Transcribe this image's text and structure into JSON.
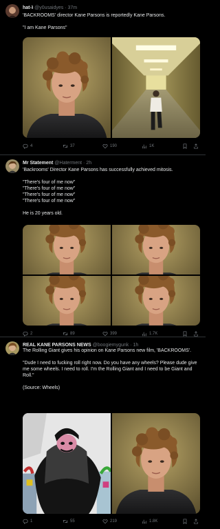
{
  "tweets": [
    {
      "name": "hat-ʇ",
      "handle_time": "@y0usaidyes · 37m",
      "lines": [
        "'BACKROOMS' director Kane Parsons is reportedly Kane Parsons.",
        "",
        "\"I am Kane Parsons\""
      ],
      "stats": {
        "replies": "4",
        "retweets": "37",
        "likes": "190",
        "views": "1K"
      }
    },
    {
      "name": "Mr Statement",
      "handle_time": "@Haterment · 2h",
      "lines": [
        "'Backrooms' Director Kane Parsons has successfully achieved mitosis.",
        "",
        "\"There's four of me now\"",
        "\"There's four of me now\"",
        "\"There's four of me now\"",
        "\"There's four of me now\"",
        "",
        "He is 20 years old."
      ],
      "stats": {
        "replies": "2",
        "retweets": "89",
        "likes": "399",
        "views": "1.7K"
      }
    },
    {
      "name": "REAL KANE PARSONS NEWS",
      "handle_time": "@boogiemygunk · 1h",
      "lines": [
        "The Rolling Giant gives his opinion on Kane Parsons new film, 'BACKROOMS'.",
        "",
        "\"Dude I need to fucking roll right now. Do you have any wheels? Please dude give me some wheels. I need to roll. I'm the Rolling Giant and I need to be Giant and Roll.\"",
        "",
        "(Source: Wheels)"
      ],
      "stats": {
        "replies": "1",
        "retweets": "55",
        "likes": "219",
        "views": "1.8K"
      }
    }
  ],
  "icons": {
    "reply": "reply-icon",
    "retweet": "retweet-icon",
    "like": "heart-icon",
    "views": "views-icon",
    "bookmark": "bookmark-icon",
    "share": "share-icon"
  },
  "colors": {
    "background": "#000000",
    "text": "#e7e9ea",
    "muted": "#71767b",
    "divider": "#2f3336"
  }
}
